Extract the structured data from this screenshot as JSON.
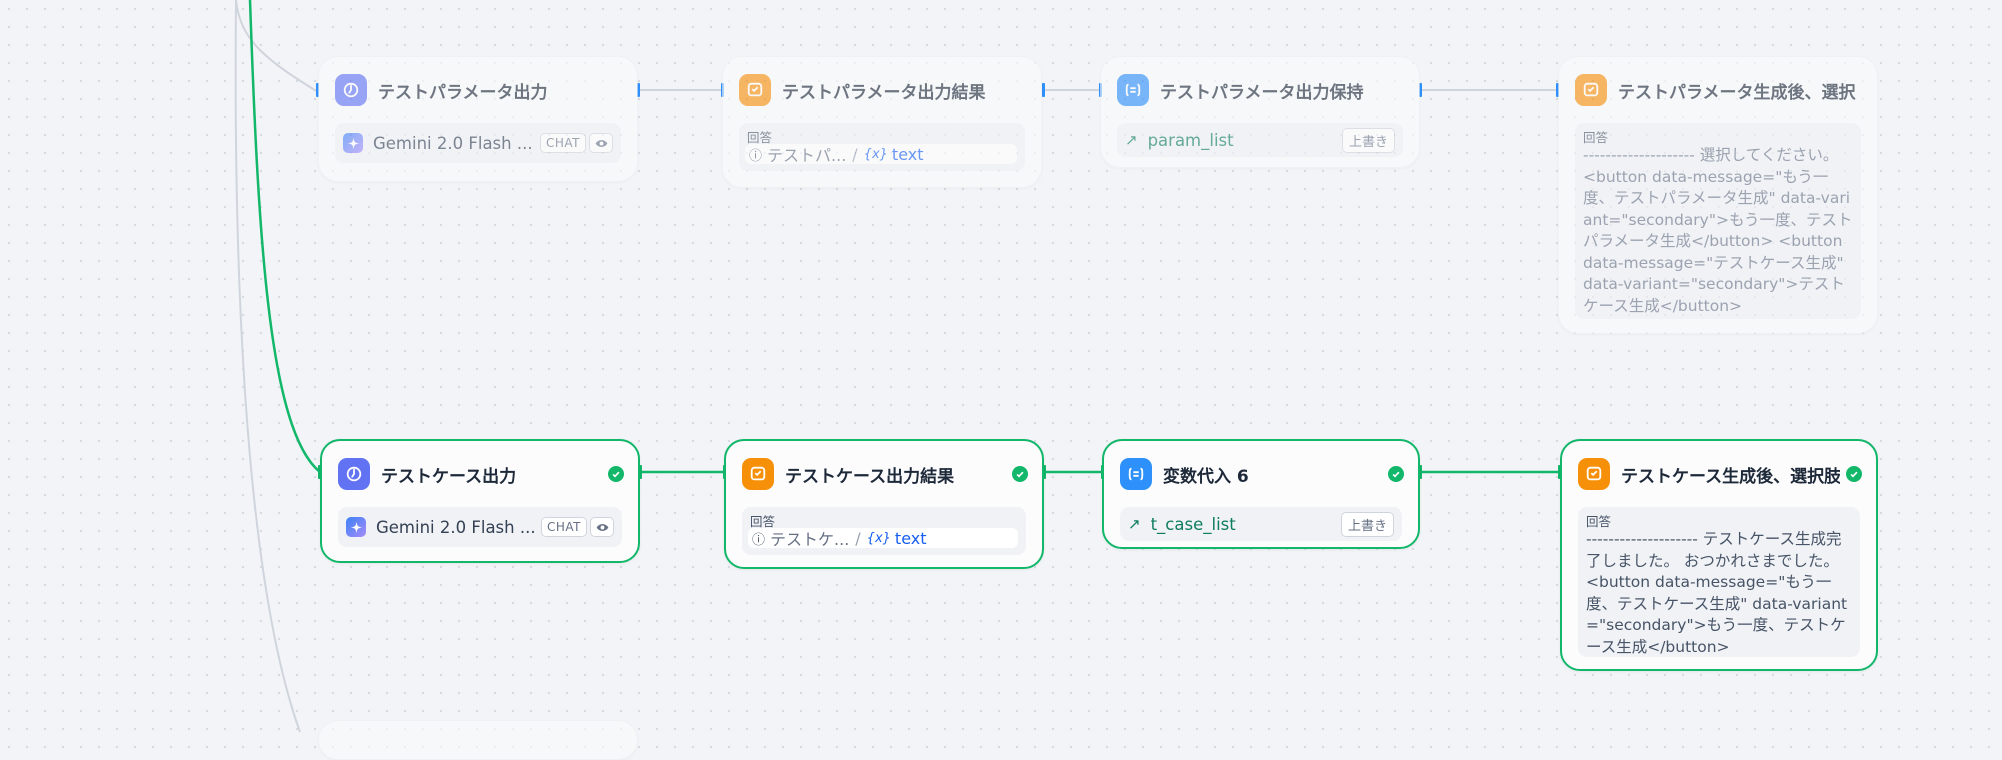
{
  "canvas": {
    "edge_color_default": "#d0d5dd",
    "edge_color_active": "#12b76a",
    "handle_color": "#2e90fa"
  },
  "nodes": {
    "param_llm": {
      "title": "テストパラメータ出力",
      "model": "Gemini 2.0 Flash ...",
      "mode": "CHAT",
      "icon": "llm-icon"
    },
    "param_answer": {
      "title": "テストパラメータ出力結果",
      "label": "回答",
      "var_source": "テストパ...",
      "var_name": "text",
      "icon": "answer-icon"
    },
    "param_assign": {
      "title": "テストパラメータ出力保持",
      "var_name": "param_list",
      "action": "上書き",
      "icon": "variable-assign-icon"
    },
    "param_after": {
      "title": "テストパラメータ生成後、選択",
      "label": "回答",
      "content": "-------------------- 選択してください。 <button data-message=\"もう一度、テストパラメータ生成\" data-variant=\"secondary\">もう一度、テストパラメータ生成</button> <button data-message=\"テストケース生成\" data-variant=\"secondary\">テストケース生成</button>",
      "icon": "answer-icon"
    },
    "case_llm": {
      "title": "テストケース出力",
      "model": "Gemini 2.0 Flash ...",
      "mode": "CHAT",
      "icon": "llm-icon"
    },
    "case_answer": {
      "title": "テストケース出力結果",
      "label": "回答",
      "var_source": "テストケ...",
      "var_name": "text",
      "icon": "answer-icon"
    },
    "case_assign": {
      "title": "変数代入 6",
      "var_name": "t_case_list",
      "action": "上書き",
      "icon": "variable-assign-icon"
    },
    "case_after": {
      "title": "テストケース生成後、選択肢",
      "label": "回答",
      "content": "-------------------- テストケース生成完了しました。 おつかれさまでした。 <button data-message=\"もう一度、テストケース生成\" data-variant=\"secondary\">もう一度、テストケース生成</button>",
      "icon": "answer-icon"
    }
  }
}
